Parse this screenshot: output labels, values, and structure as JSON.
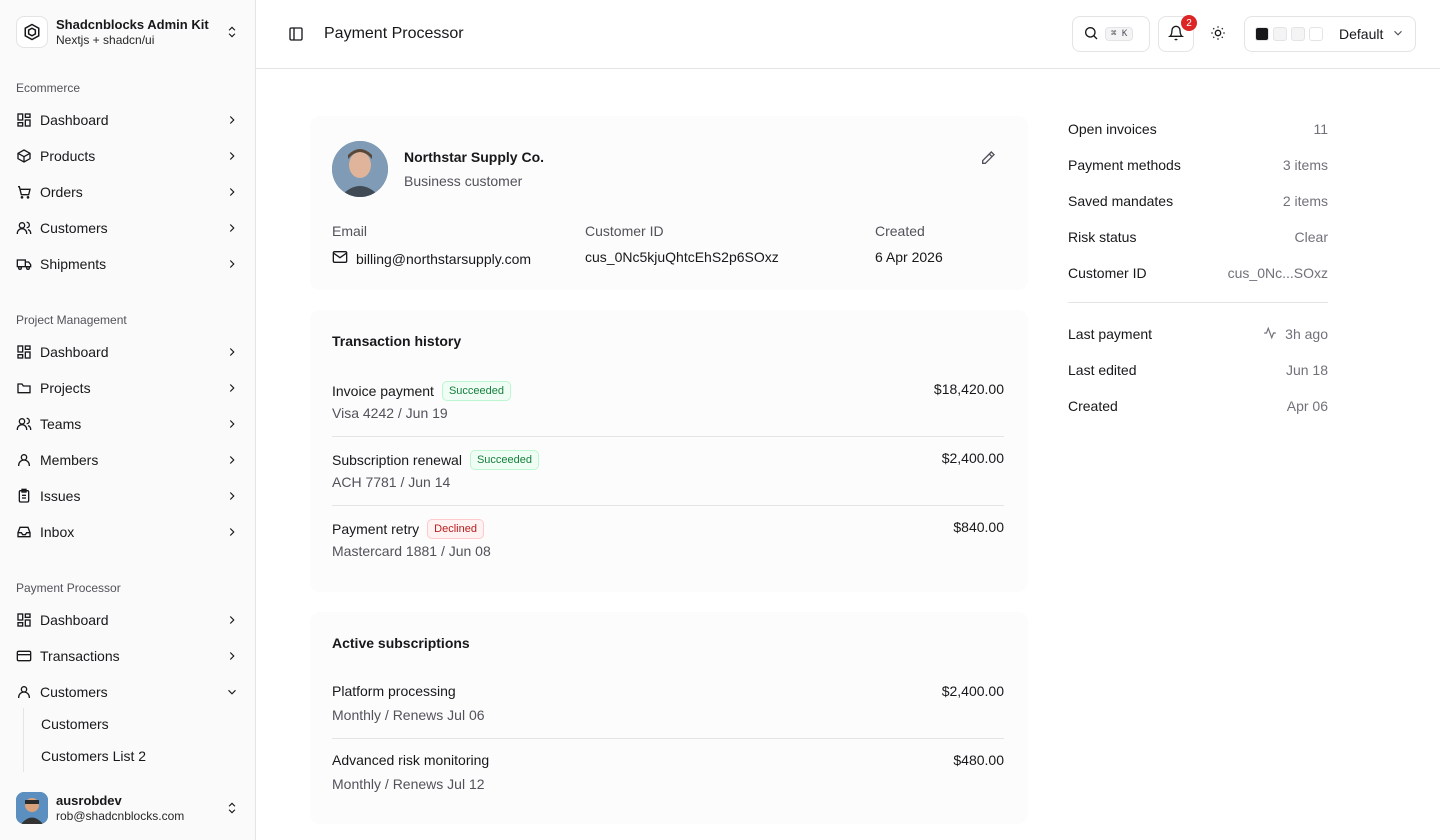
{
  "brand": {
    "title": "Shadcnblocks Admin Kit",
    "subtitle": "Nextjs + shadcn/ui"
  },
  "sidebar": {
    "groups": [
      {
        "label": "Ecommerce",
        "items": [
          {
            "label": "Dashboard",
            "icon": "dashboard-icon"
          },
          {
            "label": "Products",
            "icon": "package-icon"
          },
          {
            "label": "Orders",
            "icon": "orders-icon"
          },
          {
            "label": "Customers",
            "icon": "users-icon"
          },
          {
            "label": "Shipments",
            "icon": "truck-icon"
          }
        ]
      },
      {
        "label": "Project Management",
        "items": [
          {
            "label": "Dashboard",
            "icon": "dashboard-icon"
          },
          {
            "label": "Projects",
            "icon": "folder-icon"
          },
          {
            "label": "Teams",
            "icon": "users-icon"
          },
          {
            "label": "Members",
            "icon": "user-icon"
          },
          {
            "label": "Issues",
            "icon": "clipboard-icon"
          },
          {
            "label": "Inbox",
            "icon": "inbox-icon"
          }
        ]
      },
      {
        "label": "Payment Processor",
        "items": [
          {
            "label": "Dashboard",
            "icon": "dashboard-icon"
          },
          {
            "label": "Transactions",
            "icon": "credit-card-icon"
          },
          {
            "label": "Customers",
            "icon": "user-icon"
          }
        ]
      }
    ],
    "subitems": [
      "Customers",
      "Customers List 2"
    ]
  },
  "user": {
    "name": "ausrobdev",
    "email": "rob@shadcnblocks.com"
  },
  "header": {
    "title": "Payment Processor",
    "search_shortcut": "⌘ K",
    "notification_count": "2",
    "theme_label": "Default",
    "theme_swatches": [
      "#18181b",
      "#f4f4f5",
      "#f4f4f5",
      "#ffffff"
    ]
  },
  "customer": {
    "name": "Northstar Supply Co.",
    "type": "Business customer",
    "email_label": "Email",
    "email": "billing@northstarsupply.com",
    "id_label": "Customer ID",
    "id": "cus_0Nc5kjuQhtcEhS2p6SOxz",
    "created_label": "Created",
    "created": "6 Apr 2026"
  },
  "transactions": {
    "title": "Transaction history",
    "rows": [
      {
        "title": "Invoice payment",
        "status": "Succeeded",
        "sub": "Visa 4242 / Jun 19",
        "amount": "$18,420.00"
      },
      {
        "title": "Subscription renewal",
        "status": "Succeeded",
        "sub": "ACH 7781 / Jun 14",
        "amount": "$2,400.00"
      },
      {
        "title": "Payment retry",
        "status": "Declined",
        "sub": "Mastercard 1881 / Jun 08",
        "amount": "$840.00"
      }
    ]
  },
  "subscriptions": {
    "title": "Active subscriptions",
    "rows": [
      {
        "title": "Platform processing",
        "sub": "Monthly / Renews Jul 06",
        "amount": "$2,400.00"
      },
      {
        "title": "Advanced risk monitoring",
        "sub": "Monthly / Renews Jul 12",
        "amount": "$480.00"
      }
    ]
  },
  "summary": {
    "top": [
      {
        "label": "Open invoices",
        "value": "11"
      },
      {
        "label": "Payment methods",
        "value": "3 items"
      },
      {
        "label": "Saved mandates",
        "value": "2 items"
      },
      {
        "label": "Risk status",
        "value": "Clear"
      },
      {
        "label": "Customer ID",
        "value": "cus_0Nc...SOxz"
      }
    ],
    "bottom": [
      {
        "label": "Last payment",
        "value": "3h ago"
      },
      {
        "label": "Last edited",
        "value": "Jun 18"
      },
      {
        "label": "Created",
        "value": "Apr 06"
      }
    ]
  },
  "colors": {
    "success": "#15803d",
    "danger": "#b91c1c",
    "badge_red": "#dc2626"
  }
}
